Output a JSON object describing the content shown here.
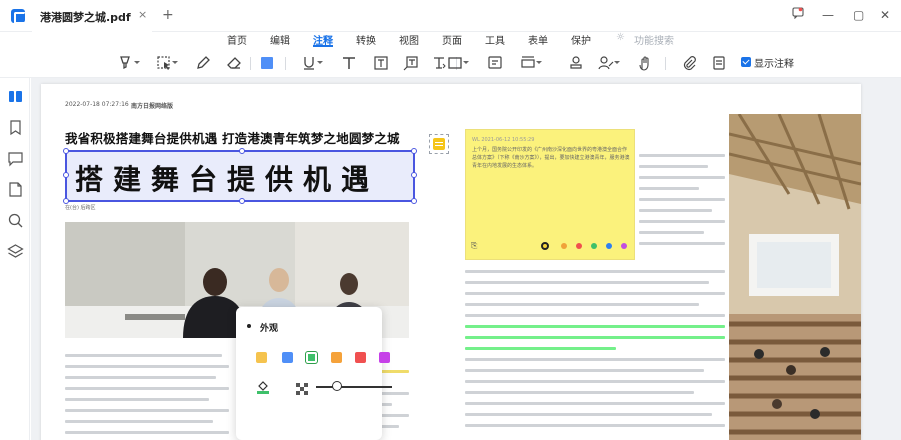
{
  "tab": {
    "title": "港港圆梦之城.pdf",
    "close": "×",
    "add": "+"
  },
  "window": {
    "feedback_icon": "feedback-icon",
    "min": "—",
    "max": "▢",
    "close": "✕"
  },
  "menu": [
    {
      "label": "首页",
      "active": false
    },
    {
      "label": "编辑",
      "active": false
    },
    {
      "label": "注释",
      "active": true
    },
    {
      "label": "转换",
      "active": false
    },
    {
      "label": "视图",
      "active": false
    },
    {
      "label": "页面",
      "active": false
    },
    {
      "label": "工具",
      "active": false
    },
    {
      "label": "表单",
      "active": false
    },
    {
      "label": "保护",
      "active": false
    }
  ],
  "search": {
    "label": "功能搜索",
    "icon": "lightbulb-icon"
  },
  "toolbar": {
    "show_annotations": "显示注释",
    "tools": [
      "highlight-icon",
      "area-highlight-icon",
      "pencil-icon",
      "eraser-icon",
      "color-block-icon",
      "underline-icon",
      "text-icon",
      "textbox-icon",
      "callout-icon",
      "typewriter-icon",
      "rectangle-icon",
      "note-icon",
      "area-measure-icon",
      "stamp-icon",
      "signature-icon",
      "hand-icon",
      "attachment-icon",
      "annotation-list-icon"
    ],
    "show_annotations_checked": true
  },
  "sidebar": [
    "thumbnails-icon",
    "bookmark-icon",
    "comment-icon",
    "attachment-page-icon",
    "search-icon",
    "layers-icon"
  ],
  "doc": {
    "date": "2022-07-18 07:27:16",
    "publisher": "南方日报网络版",
    "headline": "我省积极搭建舞台提供机遇  打造港澳青年筑梦之地圆梦之城",
    "big_title": "搭建舞台提供机遇",
    "caption": "在(台) 后跨区"
  },
  "note": {
    "header": "WL 2021-06-12 10:55:29",
    "body": "上个月，国务院公开印发的《广州南沙深化面向世界的粤港澳全面合作总体方案》（下称《南沙方案》），提出，要加快建立港澳青年，服务港澳青年在内地发展的生态体系。",
    "colors": [
      "#1a1a1a",
      "#f0a23a",
      "#f0504d",
      "#3ec06a",
      "#2f7ff0",
      "#1fb3d8",
      "#c24ee0"
    ],
    "selected": 0
  },
  "popup": {
    "title": "外观",
    "swatches": [
      "#f5c34e",
      "#4f8ff7",
      "#3ec06a",
      "#f5a23a",
      "#f05050",
      "#c640e8"
    ],
    "selected": 2,
    "opacity_value": 0.3,
    "fill_icon": "fill-color-icon",
    "opacity_icon": "opacity-icon"
  }
}
